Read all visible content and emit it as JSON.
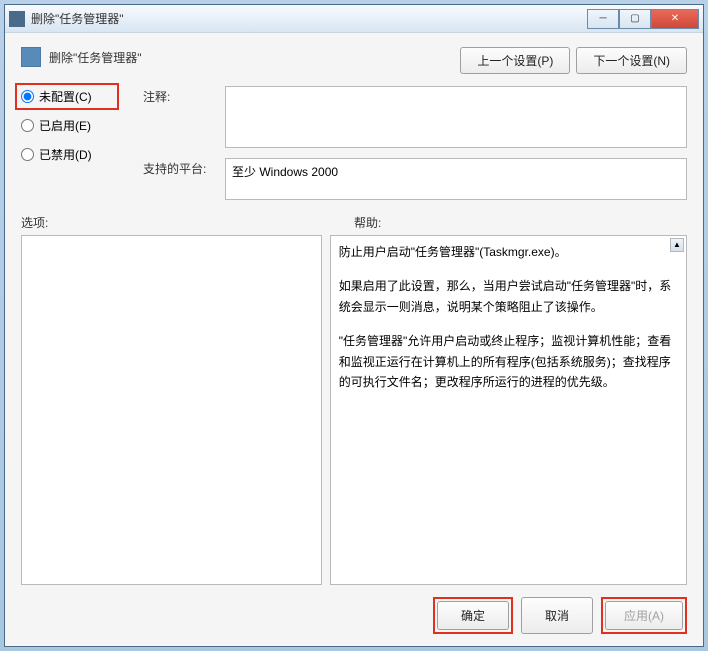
{
  "window": {
    "title": "删除\"任务管理器\""
  },
  "header": {
    "title": "删除\"任务管理器\"",
    "prev_button": "上一个设置(P)",
    "next_button": "下一个设置(N)"
  },
  "radios": {
    "not_configured": "未配置(C)",
    "enabled": "已启用(E)",
    "disabled": "已禁用(D)"
  },
  "fields": {
    "comment_label": "注释:",
    "comment_value": "",
    "platform_label": "支持的平台:",
    "platform_value": "至少 Windows 2000"
  },
  "panes": {
    "options_label": "选项:",
    "help_label": "帮助:",
    "help_paragraphs": [
      "防止用户启动\"任务管理器\"(Taskmgr.exe)。",
      "如果启用了此设置，那么，当用户尝试启动\"任务管理器\"时，系统会显示一则消息，说明某个策略阻止了该操作。",
      "\"任务管理器\"允许用户启动或终止程序；监视计算机性能；查看和监视正运行在计算机上的所有程序(包括系统服务)；查找程序的可执行文件名；更改程序所运行的进程的优先级。"
    ]
  },
  "footer": {
    "ok": "确定",
    "cancel": "取消",
    "apply": "应用(A)"
  }
}
